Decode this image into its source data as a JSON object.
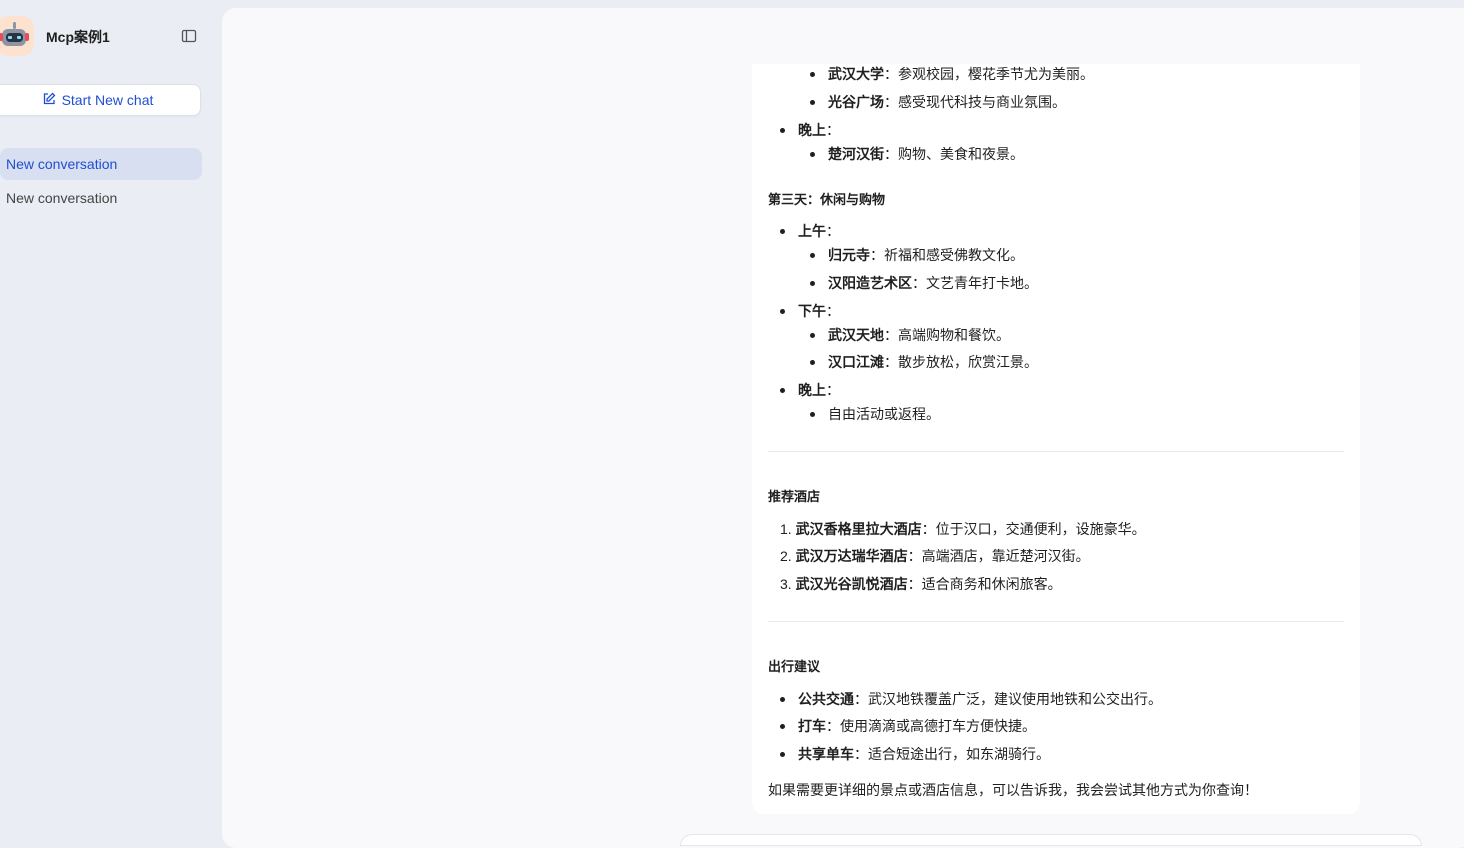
{
  "sidebar": {
    "app_title": "Mcp案例1",
    "new_chat_label": "Start New chat",
    "conversations": [
      {
        "label": "New conversation",
        "active": true
      },
      {
        "label": "New conversation",
        "active": false
      }
    ]
  },
  "message": {
    "day2_items": [
      {
        "bold": "武汉大学",
        "text": "：参观校园，樱花季节尤为美丽。"
      },
      {
        "bold": "光谷广场",
        "text": "：感受现代科技与商业氛围。"
      }
    ],
    "day2_evening": {
      "bold": "晚上",
      "text": "："
    },
    "day2_evening_items": [
      {
        "bold": "楚河汉街",
        "text": "：购物、美食和夜景。"
      }
    ],
    "day3_title": "第三天：休闲与购物",
    "day3": [
      {
        "bold": "上午",
        "text": "：",
        "items": [
          {
            "bold": "归元寺",
            "text": "：祈福和感受佛教文化。"
          },
          {
            "bold": "汉阳造艺术区",
            "text": "：文艺青年打卡地。"
          }
        ]
      },
      {
        "bold": "下午",
        "text": "：",
        "items": [
          {
            "bold": "武汉天地",
            "text": "：高端购物和餐饮。"
          },
          {
            "bold": "汉口江滩",
            "text": "：散步放松，欣赏江景。"
          }
        ]
      },
      {
        "bold": "晚上",
        "text": "：",
        "items": [
          {
            "bold": "",
            "text": "自由活动或返程。"
          }
        ]
      }
    ],
    "hotels_title": "推荐酒店",
    "hotels": [
      {
        "num": "1.",
        "bold": "武汉香格里拉大酒店",
        "text": "：位于汉口，交通便利，设施豪华。"
      },
      {
        "num": "2.",
        "bold": "武汉万达瑞华酒店",
        "text": "：高端酒店，靠近楚河汉街。"
      },
      {
        "num": "3.",
        "bold": "武汉光谷凯悦酒店",
        "text": "：适合商务和休闲旅客。"
      }
    ],
    "travel_title": "出行建议",
    "travel": [
      {
        "bold": "公共交通",
        "text": "：武汉地铁覆盖广泛，建议使用地铁和公交出行。"
      },
      {
        "bold": "打车",
        "text": "：使用滴滴或高德打车方便快捷。"
      },
      {
        "bold": "共享单车",
        "text": "：适合短途出行，如东湖骑行。"
      }
    ],
    "closing": "如果需要更详细的景点或酒店信息，可以告诉我，我会尝试其他方式为你查询！"
  }
}
